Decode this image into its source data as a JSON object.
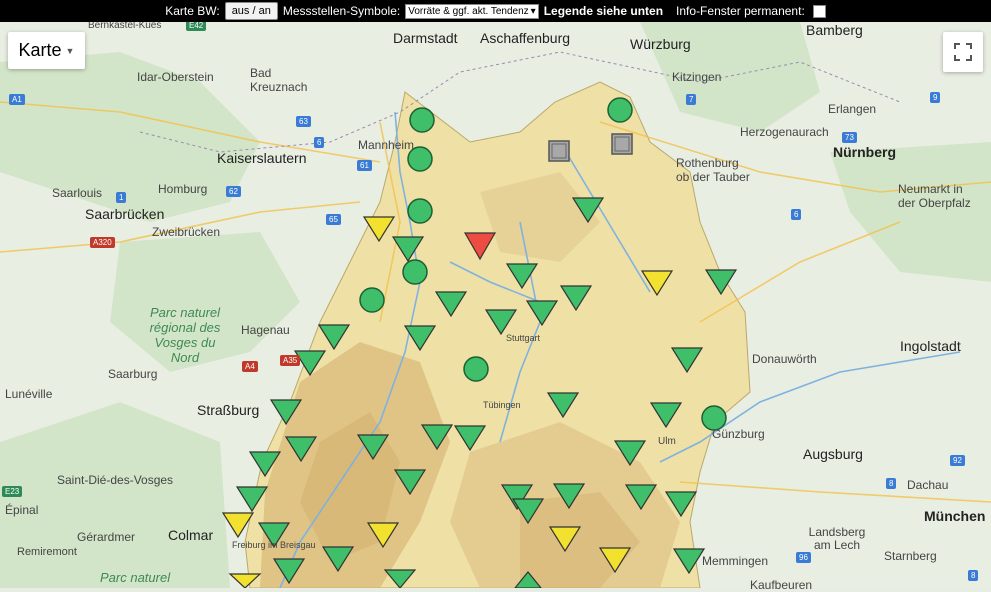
{
  "toolbar": {
    "karte_bw_label": "Karte BW:",
    "toggle_button": "aus / an",
    "symbols_label": "Messstellen-Symbole:",
    "symbols_selected": "Vorräte & ggf. akt. Tendenz",
    "legend_note": "Legende siehe unten",
    "info_window_label": "Info-Fenster permanent:"
  },
  "map_type_button": "Karte",
  "fullscreen_icon": "fullscreen-icon",
  "colors": {
    "green": "#3fbf6a",
    "yellow": "#f2e12f",
    "red": "#ee4b43",
    "gray": "#a8a8a8",
    "bw_region": "#efe1a6"
  },
  "places": [
    {
      "name": "Bernkastel-Kues"
    },
    {
      "name": "Darmstadt"
    },
    {
      "name": "Aschaffenburg"
    },
    {
      "name": "Würzburg"
    },
    {
      "name": "Bamberg"
    },
    {
      "name": "Idar-Oberstein"
    },
    {
      "name": "Bad Kreuznach"
    },
    {
      "name": "Kitzingen"
    },
    {
      "name": "Erlangen"
    },
    {
      "name": "Herzogenaurach"
    },
    {
      "name": "Kaiserslautern"
    },
    {
      "name": "Mannheim"
    },
    {
      "name": "Nürnberg"
    },
    {
      "name": "Rothenburg ob der Tauber"
    },
    {
      "name": "Saarlouis"
    },
    {
      "name": "Homburg"
    },
    {
      "name": "Saarbrücken"
    },
    {
      "name": "Zweibrücken"
    },
    {
      "name": "Neumarkt in der Oberpfalz"
    },
    {
      "name": "Parc naturel régional des Vosges du Nord"
    },
    {
      "name": "Hagenau"
    },
    {
      "name": "Ingolstadt"
    },
    {
      "name": "Saarburg"
    },
    {
      "name": "Donauwörth"
    },
    {
      "name": "Lunéville"
    },
    {
      "name": "Straßburg"
    },
    {
      "name": "Tübingen"
    },
    {
      "name": "Stuttgart"
    },
    {
      "name": "Ulm"
    },
    {
      "name": "Günzburg"
    },
    {
      "name": "Augsburg"
    },
    {
      "name": "Saint-Dié-des-Vosges"
    },
    {
      "name": "Dachau"
    },
    {
      "name": "Épinal"
    },
    {
      "name": "Colmar"
    },
    {
      "name": "München"
    },
    {
      "name": "Gérardmer"
    },
    {
      "name": "Remiremont"
    },
    {
      "name": "Landsberg am Lech"
    },
    {
      "name": "Starnberg"
    },
    {
      "name": "Memmingen"
    },
    {
      "name": "Kaufbeuren"
    },
    {
      "name": "Freiburg im Breisgau"
    },
    {
      "name": "Parc naturel"
    }
  ],
  "roads": [
    "E42",
    "A1",
    "63",
    "61",
    "6",
    "65",
    "62",
    "A320",
    "A35",
    "A4",
    "E23",
    "1",
    "7",
    "73",
    "9",
    "6",
    "8",
    "92",
    "96",
    "8"
  ],
  "markers": [
    {
      "shape": "circle",
      "color": "green"
    },
    {
      "shape": "circle",
      "color": "green"
    },
    {
      "shape": "circle",
      "color": "green"
    },
    {
      "shape": "circle",
      "color": "green"
    },
    {
      "shape": "circle",
      "color": "green"
    },
    {
      "shape": "circle",
      "color": "green"
    },
    {
      "shape": "circle",
      "color": "green"
    },
    {
      "shape": "circle",
      "color": "green"
    },
    {
      "shape": "square",
      "color": "gray"
    },
    {
      "shape": "square",
      "color": "gray"
    },
    {
      "shape": "triangle-down",
      "color": "yellow"
    },
    {
      "shape": "triangle-down",
      "color": "red"
    },
    {
      "shape": "triangle-down",
      "color": "green"
    },
    {
      "shape": "triangle-down",
      "color": "green"
    },
    {
      "shape": "triangle-down",
      "color": "green"
    },
    {
      "shape": "triangle-down",
      "color": "yellow"
    },
    {
      "shape": "triangle-down",
      "color": "green"
    },
    {
      "shape": "triangle-down",
      "color": "green"
    },
    {
      "shape": "triangle-down",
      "color": "green"
    },
    {
      "shape": "triangle-down",
      "color": "green"
    },
    {
      "shape": "triangle-down",
      "color": "green"
    },
    {
      "shape": "triangle-down",
      "color": "green"
    },
    {
      "shape": "triangle-down",
      "color": "green"
    },
    {
      "shape": "triangle-down",
      "color": "green"
    },
    {
      "shape": "triangle-down",
      "color": "green"
    },
    {
      "shape": "triangle-down",
      "color": "green"
    },
    {
      "shape": "triangle-down",
      "color": "green"
    },
    {
      "shape": "triangle-down",
      "color": "green"
    },
    {
      "shape": "triangle-down",
      "color": "green"
    },
    {
      "shape": "triangle-down",
      "color": "green"
    },
    {
      "shape": "triangle-down",
      "color": "green"
    },
    {
      "shape": "triangle-down",
      "color": "green"
    },
    {
      "shape": "triangle-down",
      "color": "green"
    },
    {
      "shape": "triangle-down",
      "color": "green"
    },
    {
      "shape": "triangle-down",
      "color": "green"
    },
    {
      "shape": "triangle-down",
      "color": "green"
    },
    {
      "shape": "triangle-down",
      "color": "green"
    },
    {
      "shape": "triangle-down",
      "color": "yellow"
    },
    {
      "shape": "triangle-down",
      "color": "green"
    },
    {
      "shape": "triangle-down",
      "color": "green"
    },
    {
      "shape": "triangle-down",
      "color": "yellow"
    },
    {
      "shape": "triangle-down",
      "color": "green"
    },
    {
      "shape": "triangle-down",
      "color": "yellow"
    },
    {
      "shape": "triangle-down",
      "color": "yellow"
    },
    {
      "shape": "triangle-down",
      "color": "green"
    },
    {
      "shape": "triangle-down",
      "color": "green"
    },
    {
      "shape": "triangle-down",
      "color": "green"
    },
    {
      "shape": "triangle-down",
      "color": "yellow"
    },
    {
      "shape": "triangle-down",
      "color": "green"
    },
    {
      "shape": "triangle-down",
      "color": "green"
    },
    {
      "shape": "triangle-down",
      "color": "green"
    }
  ]
}
